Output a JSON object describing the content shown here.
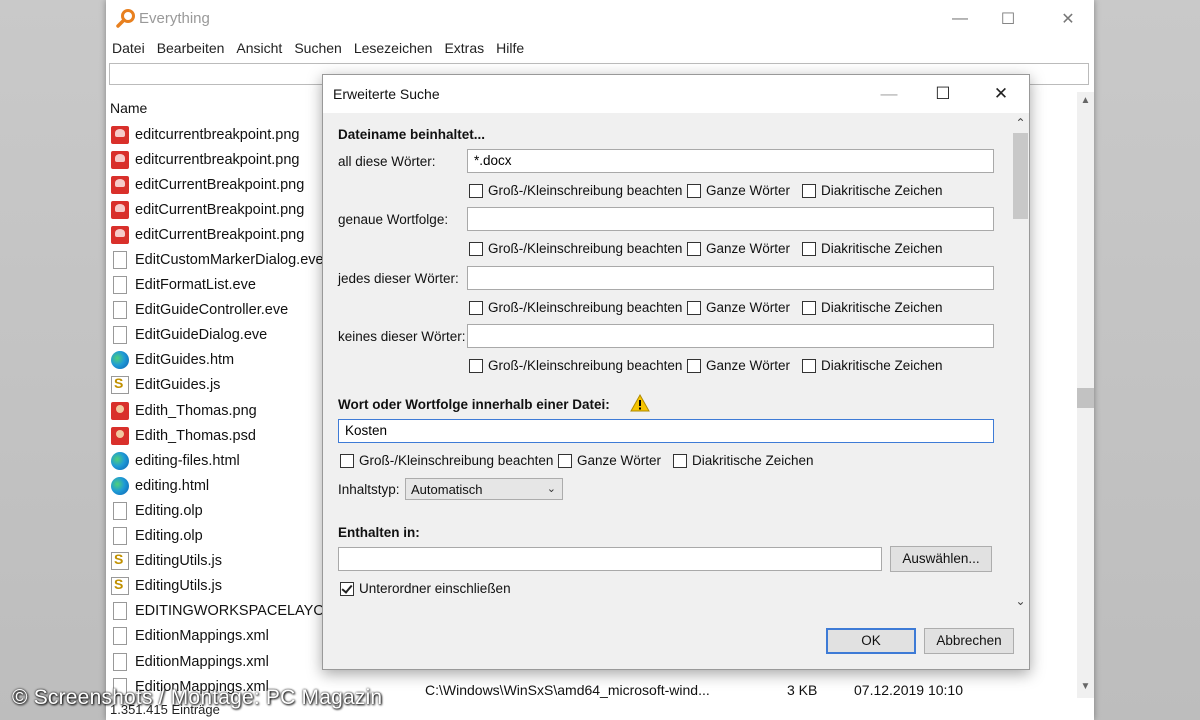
{
  "main_window": {
    "title": "Everything",
    "menu": [
      "Datei",
      "Bearbeiten",
      "Ansicht",
      "Suchen",
      "Lesezeichen",
      "Extras",
      "Hilfe"
    ],
    "column_header": "Name",
    "files": [
      {
        "name": "editcurrentbreakpoint.png",
        "icon": "png-file-icon"
      },
      {
        "name": "editcurrentbreakpoint.png",
        "icon": "png-file-icon"
      },
      {
        "name": "editCurrentBreakpoint.png",
        "icon": "png-file-icon"
      },
      {
        "name": "editCurrentBreakpoint.png",
        "icon": "png-file-icon"
      },
      {
        "name": "editCurrentBreakpoint.png",
        "icon": "png-file-icon"
      },
      {
        "name": "EditCustomMarkerDialog.eve",
        "icon": "document-icon"
      },
      {
        "name": "EditFormatList.eve",
        "icon": "document-icon"
      },
      {
        "name": "EditGuideController.eve",
        "icon": "document-icon"
      },
      {
        "name": "EditGuideDialog.eve",
        "icon": "document-icon"
      },
      {
        "name": "EditGuides.htm",
        "icon": "edge-icon"
      },
      {
        "name": "EditGuides.js",
        "icon": "script-icon"
      },
      {
        "name": "Edith_Thomas.png",
        "icon": "person-image-icon"
      },
      {
        "name": "Edith_Thomas.psd",
        "icon": "person-image-icon"
      },
      {
        "name": "editing-files.html",
        "icon": "edge-icon"
      },
      {
        "name": "editing.html",
        "icon": "edge-icon"
      },
      {
        "name": "Editing.olp",
        "icon": "document-icon"
      },
      {
        "name": "Editing.olp",
        "icon": "document-icon"
      },
      {
        "name": "EditingUtils.js",
        "icon": "script-icon"
      },
      {
        "name": "EditingUtils.js",
        "icon": "script-icon"
      },
      {
        "name": "EDITINGWORKSPACELAYOUT",
        "icon": "document-icon"
      },
      {
        "name": "EditionMappings.xml",
        "icon": "document-icon"
      },
      {
        "name": "EditionMappings.xml",
        "icon": "document-icon"
      },
      {
        "name": "EditionMappings.xml",
        "icon": "document-icon"
      }
    ],
    "last_row": {
      "path": "C:\\Windows\\WinSxS\\amd64_microsoft-wind...",
      "size": "3 KB",
      "modified": "07.12.2019 10:10"
    },
    "status": "1.351.415 Einträge"
  },
  "dialog": {
    "title": "Erweiterte Suche",
    "filename_section": "Dateiname beinhaltet...",
    "rows": [
      {
        "label": "all diese Wörter:",
        "value": "*.docx"
      },
      {
        "label": "genaue Wortfolge:",
        "value": ""
      },
      {
        "label": "jedes dieser Wörter:",
        "value": ""
      },
      {
        "label": "keines dieser Wörter:",
        "value": ""
      }
    ],
    "options": {
      "case": "Groß-/Kleinschreibung beachten",
      "whole": "Ganze Wörter",
      "diacritics": "Diakritische Zeichen"
    },
    "content_section": "Wort oder Wortfolge innerhalb einer Datei:",
    "content_value": "Kosten",
    "content_type_label": "Inhaltstyp:",
    "content_type_value": "Automatisch",
    "contained_section": "Enthalten in:",
    "contained_value": "",
    "browse_button": "Auswählen...",
    "subfolders_label": "Unterordner einschließen",
    "subfolders_checked": true,
    "ok_button": "OK",
    "cancel_button": "Abbrechen"
  },
  "watermark": "© Screenshots / Montage: PC Magazin",
  "colors": {
    "accent": "#3e7bd6",
    "warning": "#f5c400",
    "png_icon": "#d9302b"
  }
}
